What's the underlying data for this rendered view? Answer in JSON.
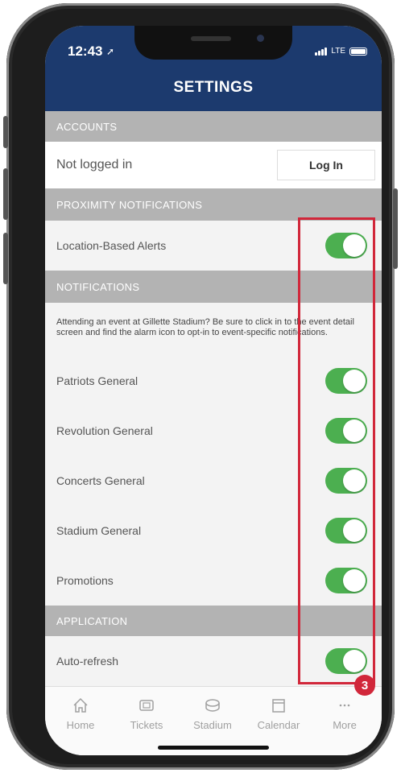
{
  "status_bar": {
    "time": "12:43",
    "network": "LTE"
  },
  "header": {
    "title": "SETTINGS"
  },
  "sections": {
    "accounts": "ACCOUNTS",
    "proximity": "PROXIMITY NOTIFICATIONS",
    "notifications": "NOTIFICATIONS",
    "application": "APPLICATION"
  },
  "accounts": {
    "status": "Not logged in",
    "login_label": "Log In"
  },
  "proximity": {
    "label": "Location-Based Alerts",
    "enabled": true
  },
  "notifications_info": "Attending an event at Gillette Stadium? Be sure to click in to the event detail screen and find the alarm icon to opt-in to event-specific notifications.",
  "notifications": [
    {
      "label": "Patriots General",
      "enabled": true
    },
    {
      "label": "Revolution General",
      "enabled": true
    },
    {
      "label": "Concerts General",
      "enabled": true
    },
    {
      "label": "Stadium General",
      "enabled": true
    },
    {
      "label": "Promotions",
      "enabled": true
    }
  ],
  "application": {
    "label": "Auto-refresh",
    "enabled": true
  },
  "tabs": [
    {
      "label": "Home",
      "icon": "home-icon"
    },
    {
      "label": "Tickets",
      "icon": "ticket-icon"
    },
    {
      "label": "Stadium",
      "icon": "stadium-icon"
    },
    {
      "label": "Calendar",
      "icon": "calendar-icon"
    },
    {
      "label": "More",
      "icon": "more-icon"
    }
  ],
  "annotation": {
    "badge": "3"
  },
  "colors": {
    "header": "#1c3a6e",
    "toggle_on": "#4caf50",
    "highlight": "#d1273a",
    "section": "#b3b3b3"
  }
}
